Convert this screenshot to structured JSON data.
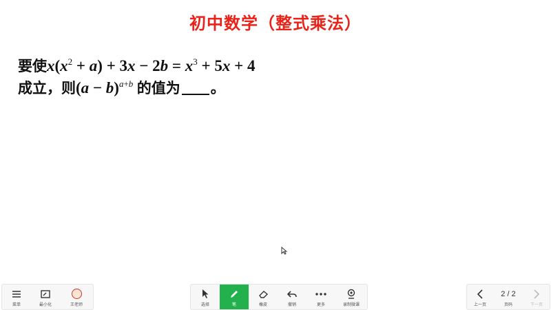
{
  "title": "初中数学（整式乘法）",
  "question": {
    "line1_prefix": "要使",
    "line2_prefix": "成立，则",
    "line2_suffix": "的值为",
    "line2_end": "。"
  },
  "toolbar": {
    "left": [
      {
        "icon": "menu-icon",
        "label": "菜单"
      },
      {
        "icon": "minimize-icon",
        "label": "最小化"
      },
      {
        "icon": "avatar-icon",
        "label": "王老师"
      }
    ],
    "center": [
      {
        "icon": "select-cursor-icon",
        "label": "选择"
      },
      {
        "icon": "pen-icon",
        "label": "笔",
        "active": true
      },
      {
        "icon": "eraser-icon",
        "label": "橡皮"
      },
      {
        "icon": "undo-icon",
        "label": "撤销"
      },
      {
        "icon": "more-icon",
        "label": "更多"
      },
      {
        "icon": "record-icon",
        "label": "录制微课"
      }
    ],
    "right": {
      "prev_label": "上一页",
      "page_indicator": "2 / 2",
      "page_label": "页码",
      "next_label": "下一页"
    }
  },
  "colors": {
    "title": "#e8231a",
    "accent_green": "#23b14d",
    "toolbar_bg": "#f7f7f7"
  }
}
